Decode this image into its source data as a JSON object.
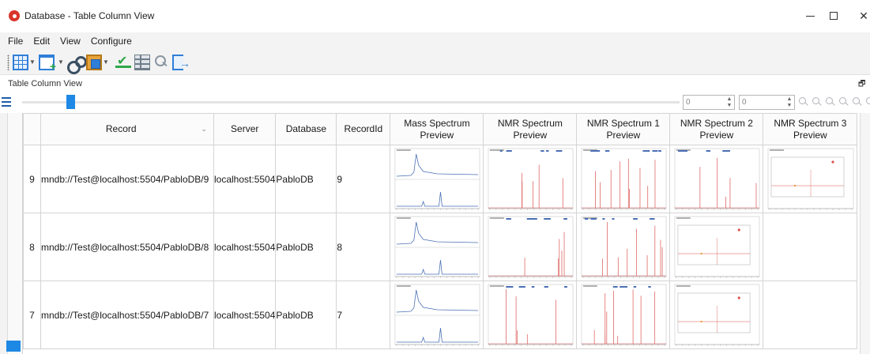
{
  "window": {
    "title": "Database - Table Column View",
    "icon": "app-logo-icon",
    "controls": [
      "minimize-icon",
      "maximize-icon",
      "close-icon"
    ],
    "close_glyph": "✕"
  },
  "menu": [
    "File",
    "Edit",
    "View",
    "Configure"
  ],
  "toolbar": {
    "icons": [
      "table-view-icon",
      "new-window-icon",
      "settings-gears-icon",
      "clipboard-icon",
      "check-icon",
      "grid-icon",
      "search-user-icon",
      "exit-icon"
    ]
  },
  "view_label": "Table Column View",
  "pin_glyph": "🗗",
  "slider": {
    "spin_a": "0",
    "spin_b": "0"
  },
  "grid": {
    "columns": [
      "Record",
      "Server",
      "Database",
      "RecordId",
      "Mass Spectrum Preview",
      "NMR Spectrum Preview",
      "NMR Spectrum 1 Preview",
      "NMR Spectrum 2 Preview",
      "NMR Spectrum 3 Preview"
    ],
    "rows": [
      {
        "index": "9",
        "record": "mndb://Test@localhost:5504/PabloDB/9",
        "server": "localhost:5504",
        "database": "PabloDB",
        "record_id": "9",
        "previews": [
          "mass",
          "nmr",
          "nmr1",
          "nmr2",
          "nmr3"
        ]
      },
      {
        "index": "8",
        "record": "mndb://Test@localhost:5504/PabloDB/8",
        "server": "localhost:5504",
        "database": "PabloDB",
        "record_id": "8",
        "previews": [
          "mass",
          "nmr",
          "nmr1",
          "nmr3",
          ""
        ]
      },
      {
        "index": "7",
        "record": "mndb://Test@localhost:5504/PabloDB/7",
        "server": "localhost:5504",
        "database": "PabloDB",
        "record_id": "7",
        "previews": [
          "mass",
          "nmr",
          "nmr1",
          "nmr3",
          ""
        ]
      }
    ]
  },
  "colors": {
    "accent": "#1e88e5",
    "spectrum_red": "#d9534f",
    "spectrum_blue": "#4a6fb5"
  }
}
